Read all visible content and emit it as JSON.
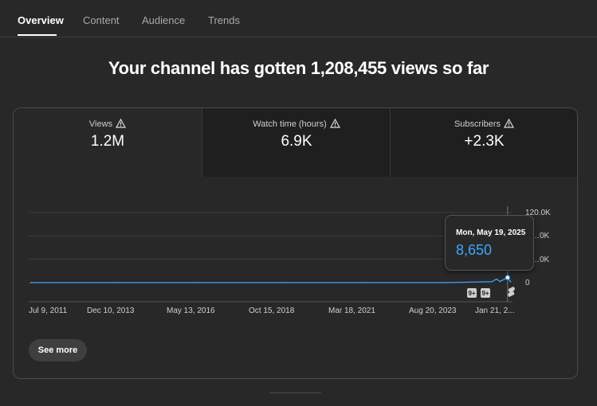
{
  "tabs": [
    {
      "label": "Overview",
      "active": true
    },
    {
      "label": "Content",
      "active": false
    },
    {
      "label": "Audience",
      "active": false
    },
    {
      "label": "Trends",
      "active": false
    }
  ],
  "headline": "Your channel has gotten 1,208,455 views so far",
  "metrics": [
    {
      "label": "Views",
      "value": "1.2M",
      "icon": "warning-icon"
    },
    {
      "label": "Watch time (hours)",
      "value": "6.9K",
      "icon": "warning-icon"
    },
    {
      "label": "Subscribers",
      "value": "+2.3K",
      "icon": "warning-icon"
    }
  ],
  "chart_data": {
    "type": "line",
    "series": [
      {
        "x": [
          "2011-07-09",
          "2013-12-10",
          "2016-05-13",
          "2018-10-15",
          "2021-03-18",
          "2023-08-20",
          "2024-12-01",
          "2025-01-21",
          "2025-03-01",
          "2025-05-19",
          "2025-06-20"
        ],
        "values": [
          0,
          0,
          0,
          0,
          0,
          0,
          1500,
          6000,
          2000,
          8650,
          1500
        ]
      }
    ],
    "x_tick_labels": [
      "Jul 9, 2011",
      "Dec 10, 2013",
      "May 13, 2016",
      "Oct 15, 2018",
      "Mar 18, 2021",
      "Aug 20, 2023",
      "Jan 21, 2..."
    ],
    "y_tick_labels": [
      "120.0K",
      "…0K",
      "…0K",
      "0"
    ],
    "ylim": [
      0,
      120000
    ],
    "grid": true,
    "markers": [
      {
        "label": "9+"
      },
      {
        "label": "9+"
      }
    ],
    "line_color": "#3ea6ff"
  },
  "tooltip": {
    "date": "Mon, May 19, 2025",
    "value": "8,650"
  },
  "see_more_label": "See more",
  "colors": {
    "background": "#282828",
    "accent": "#3ea6ff",
    "card_border": "#4a4a4a",
    "inactive_tab": "#1f1f1f"
  }
}
